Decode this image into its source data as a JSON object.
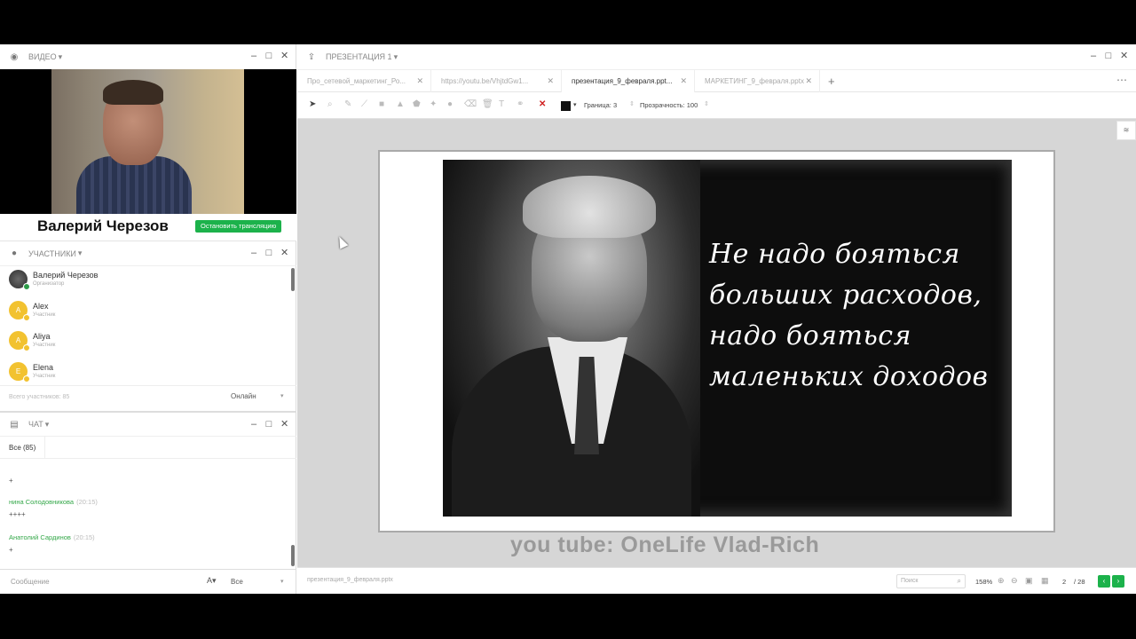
{
  "video_panel": {
    "title": "ВИДЕО",
    "presenter_name": "Валерий Черезов",
    "stop_button": "Остановить трансляцию"
  },
  "participants_panel": {
    "title": "УЧАСТНИКИ",
    "items": [
      {
        "name": "Валерий Черезов",
        "role": "Организатор",
        "avatar": ""
      },
      {
        "name": "Alex",
        "role": "Участник",
        "avatar": "A"
      },
      {
        "name": "Aliya",
        "role": "Участник",
        "avatar": "A"
      },
      {
        "name": "Elena",
        "role": "Участник",
        "avatar": "E"
      }
    ],
    "total": "Всего участников: 85",
    "filter": "Онлайн"
  },
  "chat_panel": {
    "title": "ЧАТ",
    "tab_all": "Все (85)",
    "messages": [
      {
        "author": "",
        "time": "",
        "text": "+"
      },
      {
        "author": "нина Солодовникова",
        "time": "(20:15)",
        "text": "++++"
      },
      {
        "author": "Анатолий Сардинов",
        "time": "(20:15)",
        "text": "+"
      }
    ],
    "input_placeholder": "Сообщение",
    "recipient": "Все"
  },
  "presentation_panel": {
    "title": "ПРЕЗЕНТАЦИЯ 1",
    "tabs": [
      {
        "label": "Про_сетевой_маркетинг_Ро..."
      },
      {
        "label": "https://youtu.be/VhjtdGw1..."
      },
      {
        "label": "презентация_9_февраля.ppt..."
      },
      {
        "label": "МАРКЕТИНГ_9_февраля.pptx"
      }
    ],
    "toolbar": {
      "border_label": "Граница: 3",
      "opacity_label": "Прозрачность: 100"
    },
    "slide_quote": [
      "Не надо бояться",
      "больших расходов,",
      "надо бояться",
      "маленьких доходов"
    ],
    "watermark": "you tube: OneLife Vlad-Rich",
    "status": {
      "file_name": "презентация_9_февраля.pptx",
      "search_placeholder": "Поиск",
      "zoom": "158%",
      "page_current": "2",
      "page_total": "/ 28"
    }
  }
}
